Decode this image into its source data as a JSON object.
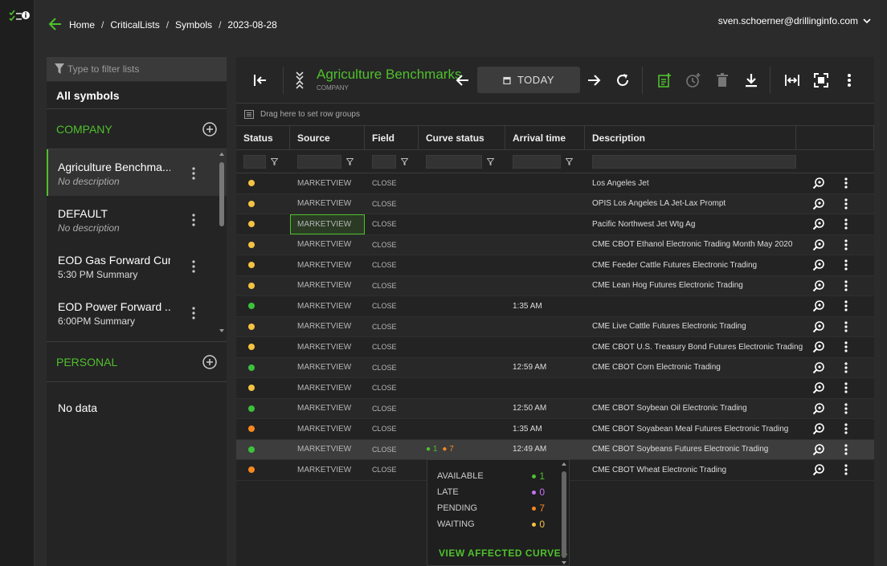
{
  "rail": {
    "icon": "checklist-info-icon"
  },
  "breadcrumb": {
    "items": [
      "Home",
      "CriticalLists",
      "Symbols",
      "2023-08-28"
    ],
    "separator": "/"
  },
  "user": {
    "email": "sven.schoerner@drillinginfo.com"
  },
  "sidebar": {
    "filter_placeholder": "Type to filter lists",
    "all_symbols": "All symbols",
    "company": {
      "title": "COMPANY",
      "items": [
        {
          "title": "Agriculture Benchma...",
          "subtitle": "No description"
        },
        {
          "title": "DEFAULT",
          "subtitle": "No description"
        },
        {
          "title": "EOD Gas Forward Cur...",
          "subtitle": "5:30 PM Summary"
        },
        {
          "title": "EOD Power Forward ...",
          "subtitle": "6:00PM Summary"
        }
      ]
    },
    "personal": {
      "title": "PERSONAL",
      "no_data": "No data"
    }
  },
  "toolbar": {
    "title": "Agriculture Benchmarks",
    "subtitle": "COMPANY",
    "today_label": "TODAY"
  },
  "grid": {
    "group_hint": "Drag here to set row groups",
    "columns": [
      "Status",
      "Source",
      "Field",
      "Curve status",
      "Arrival time",
      "Description"
    ],
    "rows": [
      {
        "status": "yellow",
        "source": "MARKETVIEW",
        "field": "CLOSE",
        "curve_status": "",
        "arrival": "",
        "description": "Los Angeles Jet"
      },
      {
        "status": "yellow",
        "source": "MARKETVIEW",
        "field": "CLOSE",
        "curve_status": "",
        "arrival": "",
        "description": "OPIS Los Angeles LA Jet-Lax Prompt"
      },
      {
        "status": "yellow",
        "source": "MARKETVIEW",
        "field": "CLOSE",
        "curve_status": "",
        "arrival": "",
        "description": "Pacific Northwest Jet Wtg Ag",
        "selected": true
      },
      {
        "status": "yellow",
        "source": "MARKETVIEW",
        "field": "CLOSE",
        "curve_status": "",
        "arrival": "",
        "description": "CME CBOT Ethanol Electronic Trading Month May 2020"
      },
      {
        "status": "yellow",
        "source": "MARKETVIEW",
        "field": "CLOSE",
        "curve_status": "",
        "arrival": "",
        "description": "CME Feeder Cattle Futures Electronic Trading"
      },
      {
        "status": "yellow",
        "source": "MARKETVIEW",
        "field": "CLOSE",
        "curve_status": "",
        "arrival": "",
        "description": "CME Lean Hog Futures Electronic Trading"
      },
      {
        "status": "green",
        "source": "MARKETVIEW",
        "field": "CLOSE",
        "curve_status": "",
        "arrival": "1:35 AM",
        "description": ""
      },
      {
        "status": "yellow",
        "source": "MARKETVIEW",
        "field": "CLOSE",
        "curve_status": "",
        "arrival": "",
        "description": "CME Live Cattle Futures Electronic Trading"
      },
      {
        "status": "yellow",
        "source": "MARKETVIEW",
        "field": "CLOSE",
        "curve_status": "",
        "arrival": "",
        "description": "CME CBOT U.S. Treasury Bond Futures Electronic Trading"
      },
      {
        "status": "green",
        "source": "MARKETVIEW",
        "field": "CLOSE",
        "curve_status": "",
        "arrival": "12:59 AM",
        "description": "CME CBOT Corn Electronic Trading"
      },
      {
        "status": "yellow",
        "source": "MARKETVIEW",
        "field": "CLOSE",
        "curve_status": "",
        "arrival": "",
        "description": ""
      },
      {
        "status": "green",
        "source": "MARKETVIEW",
        "field": "CLOSE",
        "curve_status": "",
        "arrival": "12:50 AM",
        "description": "CME CBOT Soybean Oil Electronic Trading"
      },
      {
        "status": "orange",
        "source": "MARKETVIEW",
        "field": "CLOSE",
        "curve_status": "",
        "arrival": "1:35 AM",
        "description": "CME CBOT Soyabean Meal Futures Electronic Trading"
      },
      {
        "status": "green",
        "source": "MARKETVIEW",
        "field": "CLOSE",
        "curve_status": "1|7",
        "arrival": "12:49 AM",
        "description": "CME CBOT Soybeans Futures Electronic Trading",
        "highlight": true
      },
      {
        "status": "orange",
        "source": "MARKETVIEW",
        "field": "CLOSE",
        "curve_status": "",
        "arrival": "",
        "description": "CME CBOT Wheat Electronic Trading"
      }
    ]
  },
  "curve_popup": {
    "rows": [
      {
        "label": "AVAILABLE",
        "value": "1",
        "color": "#4fc02c"
      },
      {
        "label": "LATE",
        "value": "0",
        "color": "#c873f5"
      },
      {
        "label": "PENDING",
        "value": "7",
        "color": "#f7881f"
      },
      {
        "label": "WAITING",
        "value": "0",
        "color": "#f5c242"
      }
    ],
    "link": "VIEW AFFECTED CURVES"
  },
  "colors": {
    "accent": "#4fc02c",
    "yellow": "#f5c242",
    "green": "#3cc23c",
    "orange": "#f7881f"
  }
}
